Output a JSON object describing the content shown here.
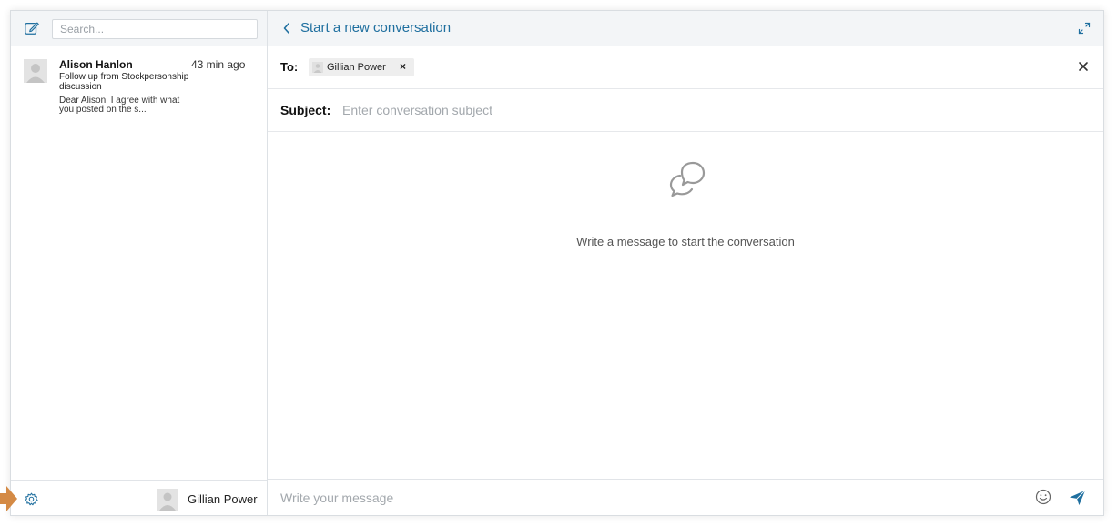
{
  "sidebar": {
    "search": {
      "placeholder": "Search...",
      "value": ""
    },
    "conversations": [
      {
        "name": "Alison Hanlon",
        "time": "43 min ago",
        "subject": "Follow up from Stockpersonship discussion",
        "preview": "Dear Alison, I agree with what you posted on the s..."
      }
    ],
    "footer": {
      "user_name": "Gillian Power"
    }
  },
  "main": {
    "header": {
      "title": "Start a new conversation"
    },
    "to": {
      "label": "To:",
      "recipients": [
        {
          "name": "Gillian Power",
          "remove": "×"
        }
      ],
      "close": "×"
    },
    "subject": {
      "label": "Subject:",
      "placeholder": "Enter conversation subject",
      "value": ""
    },
    "empty_state": {
      "text": "Write a message to start the conversation"
    },
    "composer": {
      "placeholder": "Write your message",
      "value": ""
    }
  },
  "icons": {
    "compose": "compose-icon",
    "back": "chevron-left-icon",
    "expand": "expand-icon",
    "close": "close-icon",
    "chat": "chat-bubbles-icon",
    "emoji": "emoji-icon",
    "send": "send-icon",
    "settings": "gear-icon"
  },
  "colors": {
    "accent": "#1f6f9f",
    "header_bg": "#f3f5f7",
    "pointer": "#d48a45"
  }
}
